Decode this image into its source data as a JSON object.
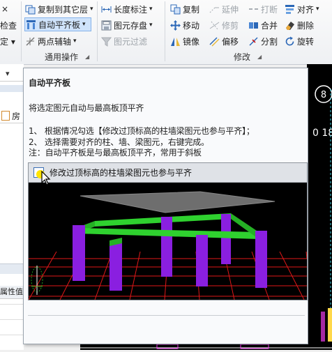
{
  "ribbon": {
    "col_left": [
      {
        "label": "×"
      },
      {
        "label": "检查"
      },
      {
        "label": "定 ▾"
      }
    ],
    "general": [
      {
        "label": "复制到其它层",
        "arrow": "▾"
      },
      {
        "label": "自动平齐板",
        "arrow": "▾"
      },
      {
        "label": "两点辅轴",
        "arrow": "▾"
      },
      {
        "label": "长度标注",
        "arrow": "▾"
      },
      {
        "label": "图元存盘",
        "arrow": "▾"
      },
      {
        "label": "图元过滤"
      }
    ],
    "general_group_label": "通用操作",
    "modify": [
      {
        "label": "复制"
      },
      {
        "label": "延伸"
      },
      {
        "label": "打断"
      },
      {
        "label": "对齐",
        "arrow": "▾"
      },
      {
        "label": "移动"
      },
      {
        "label": "修剪"
      },
      {
        "label": "合并"
      },
      {
        "label": "删除"
      },
      {
        "label": "镜像"
      },
      {
        "label": "偏移"
      },
      {
        "label": "分割"
      },
      {
        "label": "旋转"
      }
    ],
    "modify_group_label": "修改"
  },
  "left_panel": {
    "row_label": "属性值",
    "row_label_2": "房"
  },
  "canvas": {
    "axis_label": "8",
    "coord_label": "0 18"
  },
  "tooltip": {
    "title": "自动平齐板",
    "desc": "将选定图元自动与最高板顶平齐",
    "step1": "1、 根据情况勾选【修改过顶标高的柱墙梁图元也参与平齐】；",
    "step2": "2、 选择需要对齐的柱、墙、梁图元，右键完成。",
    "note": "注：自动平齐板是与最高板顶平齐，常用于斜板",
    "checkbox_label": "修改过顶标高的柱墙梁图元也参与平齐",
    "checkbox_checked": true
  },
  "colors": {
    "column": "#8a1fe0",
    "beam": "#2fd12f",
    "slab": "#6e6e6e",
    "grid": "#ff1a1a",
    "axis_ring": "#ffffff"
  }
}
